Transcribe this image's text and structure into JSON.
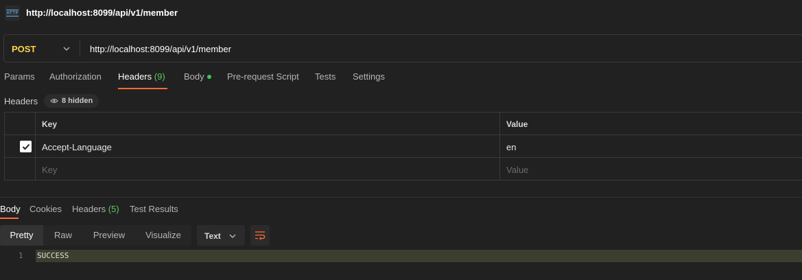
{
  "title_bar": {
    "icon": "http-icon",
    "icon_text": "HTTP",
    "title": "http://localhost:8099/api/v1/member"
  },
  "url_bar": {
    "method": "POST",
    "url": "http://localhost:8099/api/v1/member",
    "method_color": "#ffd54a"
  },
  "request_tabs": [
    {
      "label": "Params"
    },
    {
      "label": "Authorization"
    },
    {
      "label": "Headers",
      "count": "(9)",
      "active": true
    },
    {
      "label": "Body",
      "has_dot": true
    },
    {
      "label": "Pre-request Script"
    },
    {
      "label": "Tests"
    },
    {
      "label": "Settings"
    }
  ],
  "headers_section": {
    "label": "Headers",
    "hidden_badge": "8 hidden",
    "columns": {
      "key": "Key",
      "value": "Value"
    },
    "rows": [
      {
        "checked": true,
        "key": "Accept-Language",
        "value": "en"
      }
    ],
    "placeholder": {
      "key": "Key",
      "value": "Value"
    }
  },
  "response_tabs": [
    {
      "label": "Body",
      "active": true
    },
    {
      "label": "Cookies"
    },
    {
      "label": "Headers",
      "count": "(5)"
    },
    {
      "label": "Test Results"
    }
  ],
  "response_toolbar": {
    "views": [
      "Pretty",
      "Raw",
      "Preview",
      "Visualize"
    ],
    "active_view": "Pretty",
    "format": "Text"
  },
  "response_body": {
    "lines": [
      {
        "number": "1",
        "text": "SUCCESS"
      }
    ]
  },
  "colors": {
    "accent": "#ff6c37",
    "count_green": "#5fc85f",
    "dot_green": "#3cc55a"
  }
}
